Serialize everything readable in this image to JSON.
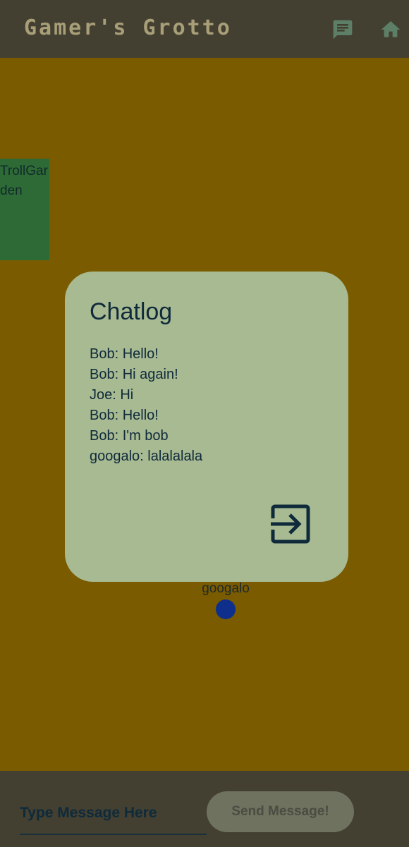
{
  "app_bar": {
    "title": "Gamer's Grotto",
    "chat_icon": "chat-bubble-icon",
    "home_icon": "home-icon"
  },
  "map": {
    "room_label": "TrollGarden",
    "player_name": "googalo"
  },
  "chat_dialog": {
    "title": "Chatlog",
    "messages": [
      "Bob: Hello!",
      "Bob: Hi again!",
      "Joe: Hi",
      "Bob: Hello!",
      "Bob: I'm bob",
      "googalo: lalalalala"
    ],
    "exit_icon": "exit-icon"
  },
  "composer": {
    "input_placeholder": "Type Message Here",
    "input_value": "",
    "send_label": "Send Message!"
  },
  "colors": {
    "app_bar": "#434031",
    "map_background": "#7a5b00",
    "room": "#2e6a36",
    "dialog": "#a8ba92",
    "player": "#0f2f8c"
  }
}
